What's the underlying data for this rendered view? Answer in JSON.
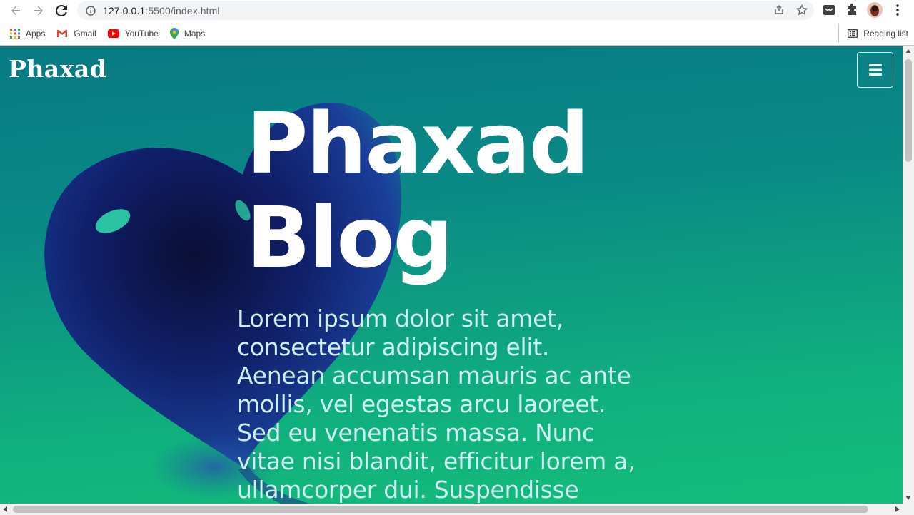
{
  "browser": {
    "url_host": "127.0.0.1",
    "url_rest": ":5500/index.html",
    "bookmarks": [
      {
        "label": "Apps",
        "icon": "apps-grid-icon"
      },
      {
        "label": "Gmail",
        "icon": "gmail-icon"
      },
      {
        "label": "YouTube",
        "icon": "youtube-icon"
      },
      {
        "label": "Maps",
        "icon": "maps-pin-icon"
      }
    ],
    "reading_list_label": "Reading list"
  },
  "page": {
    "brand": "Phaxad",
    "hero_title": "Phaxad Blog",
    "hero_text": "Lorem ipsum dolor sit amet, consectetur adipiscing elit. Aenean accumsan mauris ac ante mollis, vel egestas arcu laoreet. Sed eu venenatis massa. Nunc vitae nisi blandit, efficitur lorem a, ullamcorper dui. Suspendisse",
    "menu_icon": "hamburger-menu-icon"
  },
  "colors": {
    "gradient_top": "#077a84",
    "gradient_bottom": "#13bd7b",
    "hero_text": "#cdeef3"
  }
}
